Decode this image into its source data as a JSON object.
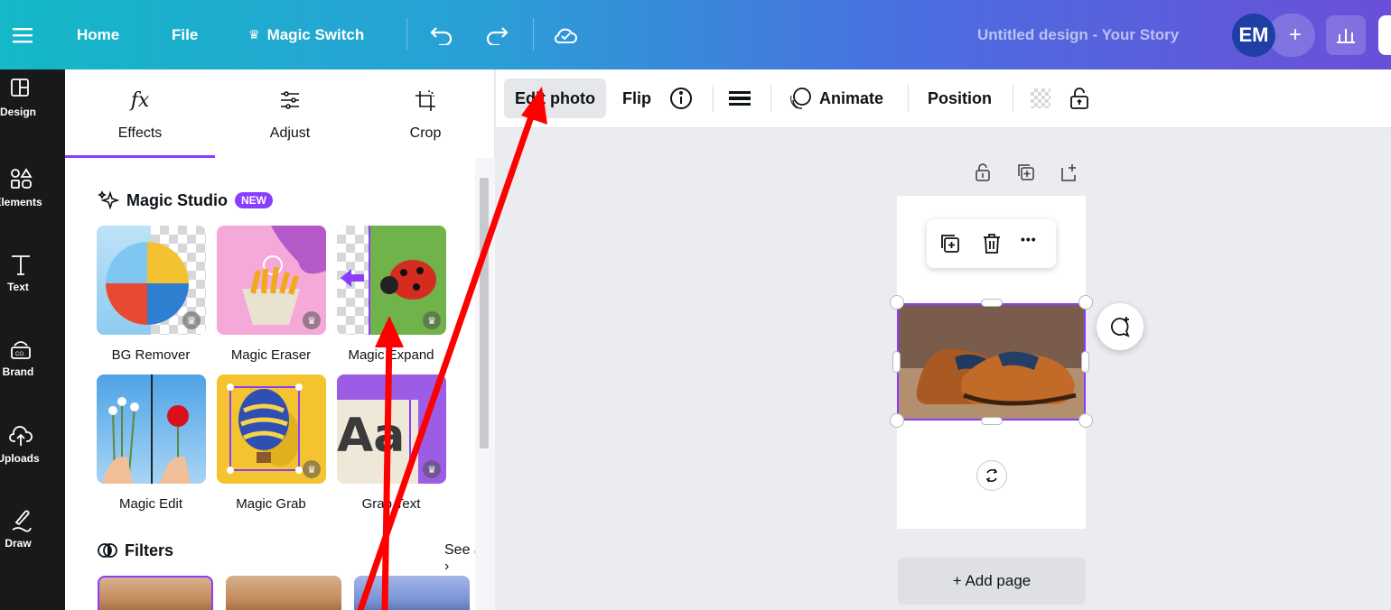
{
  "topbar": {
    "menu_icon": "hamburger-icon",
    "home": "Home",
    "file": "File",
    "magic_switch": "Magic Switch",
    "crown_glyph": "♛",
    "design_title": "Untitled design - Your Story",
    "avatar_initials": "EM",
    "plus_glyph": "+"
  },
  "rail": {
    "items": [
      {
        "label": "Design",
        "icon": "layout-icon"
      },
      {
        "label": "Elements",
        "icon": "shapes-icon"
      },
      {
        "label": "Text",
        "icon": "text-icon"
      },
      {
        "label": "Brand",
        "icon": "brand-icon"
      },
      {
        "label": "Uploads",
        "icon": "cloud-upload-icon"
      },
      {
        "label": "Draw",
        "icon": "draw-icon"
      }
    ]
  },
  "panel": {
    "tabs": [
      {
        "label": "Effects",
        "icon_text": "fx"
      },
      {
        "label": "Adjust",
        "icon": "sliders-icon"
      },
      {
        "label": "Crop",
        "icon": "crop-icon"
      }
    ],
    "magic_studio": {
      "title": "Magic Studio",
      "badge": "NEW"
    },
    "tools": [
      {
        "label": "BG Remover"
      },
      {
        "label": "Magic Eraser"
      },
      {
        "label": "Magic Expand"
      },
      {
        "label": "Magic Edit"
      },
      {
        "label": "Magic Grab"
      },
      {
        "label": "Grab Text"
      }
    ],
    "crown_glyph": "♛",
    "grab_text_glyphs": "Aa",
    "filters": {
      "title": "Filters",
      "see_all": "See all"
    }
  },
  "toolbar": {
    "edit_photo": "Edit photo",
    "flip": "Flip",
    "animate": "Animate",
    "position": "Position"
  },
  "canvas": {
    "ctx_more": "•••",
    "add_page": "+ Add page"
  },
  "colors": {
    "accent": "#8b3dff",
    "annotation_arrow": "#ff0000"
  }
}
